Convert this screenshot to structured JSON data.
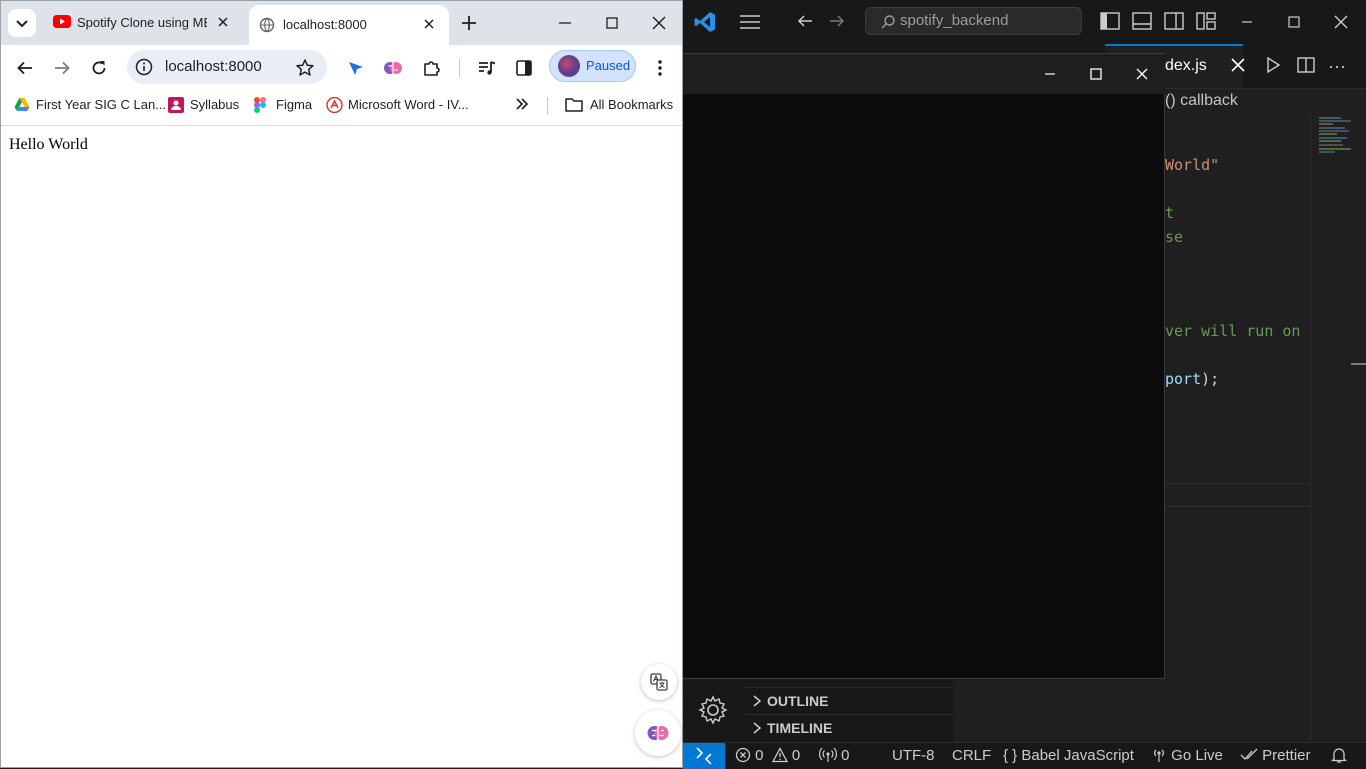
{
  "chrome": {
    "tabs": [
      {
        "title": "Spotify Clone using MERN",
        "favicon": "youtube-icon"
      },
      {
        "title": "localhost:8000",
        "favicon": "globe-icon",
        "active": true
      }
    ],
    "address_bar": "localhost:8000",
    "profile_label": "Paused",
    "bookmarks": [
      {
        "label": "First Year SIG C Lan...",
        "icon": "google-drive-icon"
      },
      {
        "label": "Syllabus",
        "icon": "syllabus-icon"
      },
      {
        "label": "Figma",
        "icon": "figma-icon"
      },
      {
        "label": "Microsoft Word - IV...",
        "icon": "pdf-icon"
      }
    ],
    "all_bookmarks_label": "All Bookmarks",
    "page_text": "Hello World"
  },
  "vscode": {
    "search_text": "spotify_backend",
    "active_tab": "dex.js",
    "breadcrumb": "() callback",
    "code_fragments": [
      {
        "text": "World\"",
        "color": "#ce9178"
      },
      {
        "text": "t",
        "color": "#6a9955"
      },
      {
        "text": "se",
        "color": "#6a9955"
      },
      {
        "text": "ver will run on",
        "color": "#6a9955"
      },
      {
        "text": "port",
        "color": "#9cdcfe",
        "suffix": ");"
      }
    ],
    "panels": [
      "OUTLINE",
      "TIMELINE"
    ],
    "status": {
      "errors": "0",
      "warnings": "0",
      "ports": "0",
      "encoding": "UTF-8",
      "eol": "CRLF",
      "language": "Babel JavaScript",
      "golive": "Go Live",
      "prettier": "Prettier"
    }
  },
  "colors": {
    "vscode_accent": "#0078d4",
    "chrome_tabstrip": "#dee3ea",
    "profile_bg": "#d3e3fd"
  }
}
